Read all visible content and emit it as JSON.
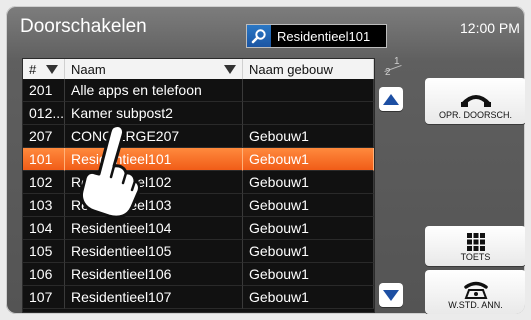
{
  "header": {
    "title": "Doorschakelen",
    "search_value": "Residentieel101",
    "time": "12:00 PM"
  },
  "table": {
    "columns": [
      "#",
      "Naam",
      "Naam gebouw"
    ],
    "rows": [
      {
        "num": "201",
        "name": "Alle apps en telefoon",
        "building": ""
      },
      {
        "num": "012...",
        "name": "Kamer subpost2",
        "building": ""
      },
      {
        "num": "207",
        "name": "CONCIËRGE207",
        "building": "Gebouw1"
      },
      {
        "num": "101",
        "name": "Residentieel101",
        "building": "Gebouw1"
      },
      {
        "num": "102",
        "name": "Residentieel102",
        "building": "Gebouw1"
      },
      {
        "num": "103",
        "name": "Residentieel103",
        "building": "Gebouw1"
      },
      {
        "num": "104",
        "name": "Residentieel104",
        "building": "Gebouw1"
      },
      {
        "num": "105",
        "name": "Residentieel105",
        "building": "Gebouw1"
      },
      {
        "num": "106",
        "name": "Residentieel106",
        "building": "Gebouw1"
      },
      {
        "num": "107",
        "name": "Residentieel107",
        "building": "Gebouw1"
      }
    ],
    "selected_index": 3
  },
  "pager": {
    "current": "1",
    "total": "2"
  },
  "buttons": {
    "opr_label": "OPR. DOORSCH.",
    "toets_label": "TOETS",
    "wstd_label": "W.STD. ANN."
  },
  "colors": {
    "selection": "#f26a1f",
    "accent_blue": "#1d4fa3"
  }
}
